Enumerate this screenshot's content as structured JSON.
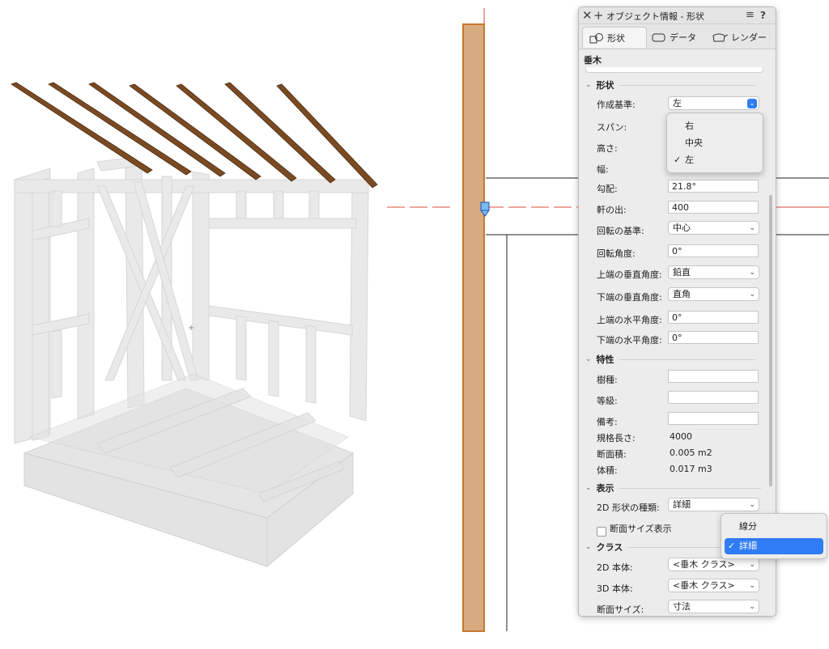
{
  "palette": {
    "title": "オブジェクト情報 - 形状",
    "tabs": [
      "形状",
      "データ",
      "レンダー"
    ],
    "selection_label": "垂木",
    "sections": {
      "shape": "形状",
      "attributes": "特性",
      "display": "表示",
      "class": "クラス"
    },
    "fields": {
      "base_label": "作成基準:",
      "base_value": "左",
      "span_label": "スパン:",
      "height_label": "高さ:",
      "width_label": "幅:",
      "pitch_label": "勾配:",
      "pitch_value": "21.8°",
      "eave_label": "軒の出:",
      "eave_value": "400",
      "rot_base_label": "回転の基準:",
      "rot_base_value": "中心",
      "rot_angle_label": "回転角度:",
      "rot_angle_value": "0°",
      "top_vert_label": "上端の垂直角度:",
      "top_vert_value": "鉛直",
      "bot_vert_label": "下端の垂直角度:",
      "bot_vert_value": "直角",
      "top_horiz_label": "上端の水平角度:",
      "top_horiz_value": "0°",
      "bot_horiz_label": "下端の水平角度:",
      "bot_horiz_value": "0°",
      "species_label": "樹種:",
      "grade_label": "等級:",
      "note_label": "備考:",
      "std_len_label": "規格長さ:",
      "std_len_value": "4000",
      "area_label": "断面積:",
      "area_value": "0.005 m2",
      "volume_label": "体積:",
      "volume_value": "0.017 m3",
      "type2d_label": "2D 形状の種類:",
      "type2d_value": "詳細",
      "section_size_label": "断面サイズ表示",
      "class2d_label": "2D 本体:",
      "class2d_value": "<垂木 クラス>",
      "class3d_label": "3D 本体:",
      "class3d_value": "<垂木 クラス>",
      "sec_size_label": "断面サイズ:",
      "sec_size_value": "寸法"
    },
    "base_menu": {
      "items": [
        "右",
        "中央",
        "左"
      ],
      "checked": "左"
    },
    "type_menu": {
      "items": [
        "線分",
        "詳細"
      ],
      "checked": "詳細"
    },
    "check_mark": "✓"
  },
  "colors": {
    "rafter": "#7a4a22",
    "wood_panel": "#d8aa80",
    "wood_edge": "#c9782d",
    "guide_red": "#e04a3c",
    "accent": "#2f7cf6"
  }
}
